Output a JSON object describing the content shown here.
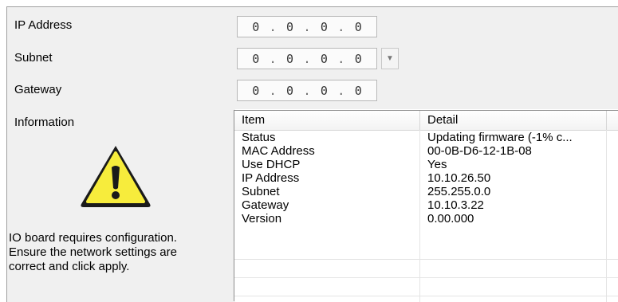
{
  "form": {
    "ip_label": "IP Address",
    "subnet_label": "Subnet",
    "gateway_label": "Gateway",
    "information_label": "Information",
    "ip_octets": [
      "0",
      "0",
      "0",
      "0"
    ],
    "subnet_octets": [
      "0",
      "0",
      "0",
      "0"
    ],
    "gateway_octets": [
      "0",
      "0",
      "0",
      "0"
    ],
    "octet_separator": ".",
    "dropdown_arrow": "▼"
  },
  "info": {
    "icon": "warning-icon",
    "icon_color": "#f7ec3c",
    "line1": "IO board requires configuration.",
    "line2": "Ensure the network settings are",
    "line3": "correct and click apply."
  },
  "table": {
    "headers": [
      "Item",
      "Detail"
    ],
    "rows": [
      {
        "item": "Status",
        "detail": "Updating firmware (-1% c..."
      },
      {
        "item": "MAC Address",
        "detail": "00-0B-D6-12-1B-08"
      },
      {
        "item": "Use DHCP",
        "detail": "Yes"
      },
      {
        "item": "IP Address",
        "detail": "10.10.26.50"
      },
      {
        "item": "Subnet",
        "detail": "255.255.0.0"
      },
      {
        "item": "Gateway",
        "detail": "10.10.3.22"
      },
      {
        "item": "Version",
        "detail": "0.00.000"
      }
    ]
  }
}
